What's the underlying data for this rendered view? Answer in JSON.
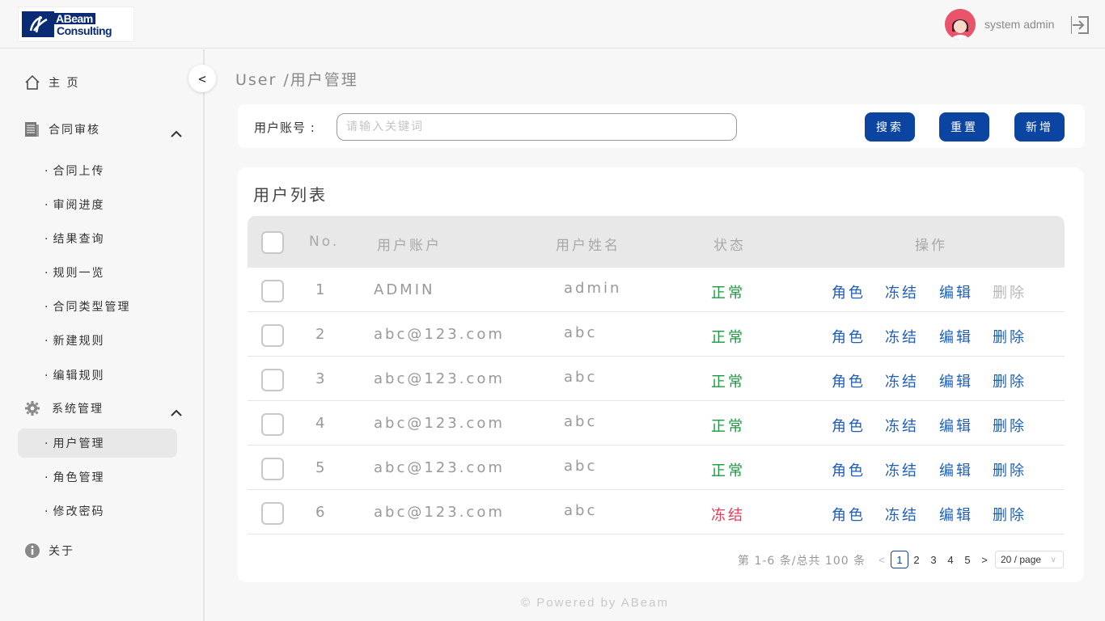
{
  "header": {
    "logo_text_1": "ABeam",
    "logo_text_2": "Consulting",
    "username": "system admin"
  },
  "sidebar": {
    "home": "主 页",
    "contract_group": "合同审核",
    "contract_items": [
      "合同上传",
      "审阅进度",
      "结果查询",
      "规则一览",
      "合同类型管理",
      "新建规则",
      "编辑规则"
    ],
    "system_group": "系统管理",
    "system_items": [
      "用户管理",
      "角色管理",
      "修改密码"
    ],
    "active_item": "用户管理",
    "about": "关于",
    "collapse": "<"
  },
  "breadcrumb": "User /用户管理",
  "search": {
    "label": "用户账号 :",
    "placeholder": "请输入关键词",
    "value": "",
    "search_btn": "搜索",
    "reset_btn": "重置",
    "add_btn": "新增"
  },
  "table": {
    "title": "用户列表",
    "headers": [
      "No.",
      "用户账户",
      "用户姓名",
      "状态",
      "操作"
    ],
    "rows": [
      {
        "no": "1",
        "account": "ADMIN",
        "name": "admin",
        "status": "正常",
        "frozen": false,
        "delete_disabled": true
      },
      {
        "no": "2",
        "account": "abc@123.com",
        "name": "abc",
        "status": "正常",
        "frozen": false,
        "delete_disabled": false
      },
      {
        "no": "3",
        "account": "abc@123.com",
        "name": "abc",
        "status": "正常",
        "frozen": false,
        "delete_disabled": false
      },
      {
        "no": "4",
        "account": "abc@123.com",
        "name": "abc",
        "status": "正常",
        "frozen": false,
        "delete_disabled": false
      },
      {
        "no": "5",
        "account": "abc@123.com",
        "name": "abc",
        "status": "正常",
        "frozen": false,
        "delete_disabled": false
      },
      {
        "no": "6",
        "account": "abc@123.com",
        "name": "abc",
        "status": "冻结",
        "frozen": true,
        "delete_disabled": false
      }
    ],
    "actions": [
      "角色",
      "冻结",
      "编辑",
      "删除"
    ]
  },
  "pagination": {
    "total_text": "第 1-6 条/总共 100 条",
    "prev": "<",
    "next": ">",
    "pages": [
      "1",
      "2",
      "3",
      "4",
      "5"
    ],
    "current": "1",
    "page_size": "20 / page"
  },
  "footer": "© Powered by ABeam",
  "colors": {
    "primary": "#0b44a1",
    "status_ok": "#1a9a3e",
    "status_frozen": "#e0405a",
    "link": "#1d5fb8",
    "avatar": "#e9546b"
  }
}
